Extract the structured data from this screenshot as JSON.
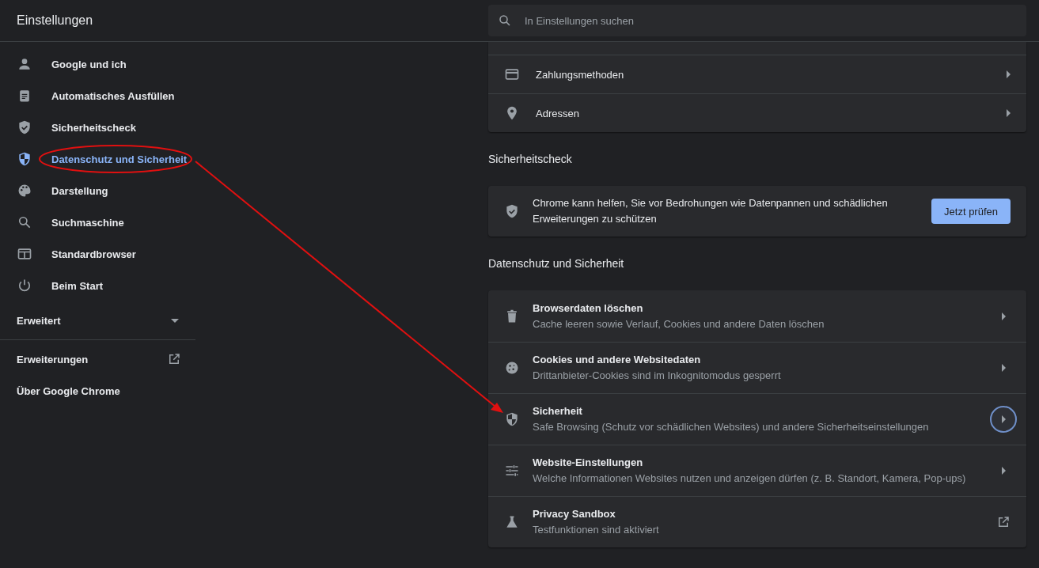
{
  "header": {
    "title": "Einstellungen",
    "search": {
      "placeholder": "In Einstellungen suchen"
    }
  },
  "sidebar": {
    "items": [
      {
        "label": "Google und ich",
        "selected": false
      },
      {
        "label": "Automatisches Ausfüllen",
        "selected": false
      },
      {
        "label": "Sicherheitscheck",
        "selected": false
      },
      {
        "label": "Datenschutz und Sicherheit",
        "selected": true
      },
      {
        "label": "Darstellung",
        "selected": false
      },
      {
        "label": "Suchmaschine",
        "selected": false
      },
      {
        "label": "Standardbrowser",
        "selected": false
      },
      {
        "label": "Beim Start",
        "selected": false
      }
    ],
    "advanced": {
      "label": "Erweitert",
      "expanded": false
    },
    "extensions": {
      "label": "Erweiterungen"
    },
    "about": {
      "label": "Über Google Chrome"
    }
  },
  "autofill_card": {
    "rows": [
      {
        "label": "Zahlungsmethoden"
      },
      {
        "label": "Adressen"
      }
    ]
  },
  "safety_check": {
    "heading": "Sicherheitscheck",
    "text": "Chrome kann helfen, Sie vor Bedrohungen wie Datenpannen und schädlichen Erweiterungen zu schützen",
    "button": "Jetzt prüfen"
  },
  "privacy": {
    "heading": "Datenschutz und Sicherheit",
    "rows": [
      {
        "title": "Browserdaten löschen",
        "subtitle": "Cache leeren sowie Verlauf, Cookies und andere Daten löschen",
        "kind": "submenu",
        "focused": false
      },
      {
        "title": "Cookies und andere Websitedaten",
        "subtitle": "Drittanbieter-Cookies sind im Inkognitomodus gesperrt",
        "kind": "submenu",
        "focused": false
      },
      {
        "title": "Sicherheit",
        "subtitle": "Safe Browsing (Schutz vor schädlichen Websites) und andere Sicherheitseinstellungen",
        "kind": "submenu",
        "focused": true
      },
      {
        "title": "Website-Einstellungen",
        "subtitle": "Welche Informationen Websites nutzen und anzeigen dürfen (z. B. Standort, Kamera, Pop-ups)",
        "kind": "submenu",
        "focused": false
      },
      {
        "title": "Privacy Sandbox",
        "subtitle": "Testfunktionen sind aktiviert",
        "kind": "external",
        "focused": false
      }
    ]
  }
}
